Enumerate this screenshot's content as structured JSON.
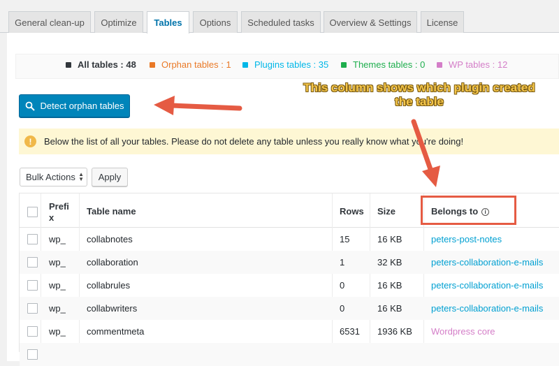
{
  "tabs": [
    {
      "label": "General clean-up"
    },
    {
      "label": "Optimize"
    },
    {
      "label": "Tables"
    },
    {
      "label": "Options"
    },
    {
      "label": "Scheduled tasks"
    },
    {
      "label": "Overview & Settings"
    },
    {
      "label": "License"
    }
  ],
  "active_tab": "Tables",
  "counts": [
    {
      "label": "All tables : 48",
      "color": "#32373c"
    },
    {
      "label": "Orphan tables : 1",
      "color": "#e97927"
    },
    {
      "label": "Plugins tables : 35",
      "color": "#00b7e8"
    },
    {
      "label": "Themes tables : 0",
      "color": "#1eae4d"
    },
    {
      "label": "WP tables : 12",
      "color": "#d47ec8"
    }
  ],
  "detect_button": {
    "label": "Detect orphan tables",
    "icon": "search-icon"
  },
  "notice": {
    "text": "Below the list of all your tables. Please do not delete any table unless you really know what you're doing!",
    "icon": "warning-icon"
  },
  "bulk_actions": {
    "selected": "Bulk Actions",
    "apply_label": "Apply"
  },
  "table": {
    "headers": {
      "prefix": "Prefix",
      "prefix_line1": "Prefi",
      "prefix_line2": "x",
      "name": "Table name",
      "rows": "Rows",
      "size": "Size",
      "belongs": "Belongs to"
    },
    "rows": [
      {
        "prefix": "wp_",
        "name": "collabnotes",
        "rows": "15",
        "size": "16 KB",
        "belongs": "peters-post-notes",
        "belongs_color": "#00a0d2"
      },
      {
        "prefix": "wp_",
        "name": "collaboration",
        "rows": "1",
        "size": "32 KB",
        "belongs": "peters-collaboration-e-mails",
        "belongs_color": "#00a0d2"
      },
      {
        "prefix": "wp_",
        "name": "collabrules",
        "rows": "0",
        "size": "16 KB",
        "belongs": "peters-collaboration-e-mails",
        "belongs_color": "#00a0d2"
      },
      {
        "prefix": "wp_",
        "name": "collabwriters",
        "rows": "0",
        "size": "16 KB",
        "belongs": "peters-collaboration-e-mails",
        "belongs_color": "#00a0d2"
      },
      {
        "prefix": "wp_",
        "name": "commentmeta",
        "rows": "6531",
        "size": "1936 KB",
        "belongs": "Wordpress core",
        "belongs_color": "#d47ec8"
      }
    ]
  },
  "annotation": {
    "line1": "This column shows which plugin created",
    "line2": "the table",
    "color": "#f5c64a",
    "arrow_color": "#e55b43"
  }
}
